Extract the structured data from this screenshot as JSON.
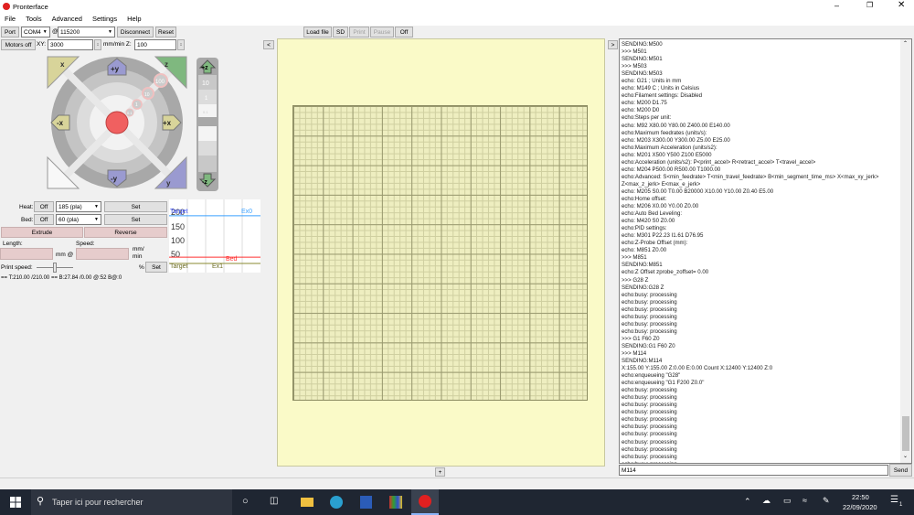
{
  "window": {
    "title": "Pronterface",
    "controls": [
      "minimize",
      "maximize",
      "close"
    ]
  },
  "menu": [
    "File",
    "Tools",
    "Advanced",
    "Settings",
    "Help"
  ],
  "toolbar": {
    "port_label": "Port",
    "port_value": "COM4",
    "at": "@",
    "baud": "115200",
    "disconnect": "Disconnect",
    "reset": "Reset",
    "motors_off": "Motors off",
    "xy_label": "XY:",
    "xy_value": "3000",
    "mm_min_z": "mm/min Z:",
    "z_value": "100",
    "collapse_left": "<"
  },
  "jog": {
    "home_x": "x",
    "home_z": "z",
    "plus_y": "+y",
    "minus_y": "-y",
    "minus_x": "-x",
    "plus_x": "+x",
    "home_y": "y",
    "steps": [
      "100",
      "10",
      "1",
      "0.1"
    ],
    "plus_z": "+z",
    "minus_z": "-z",
    "z_steps": [
      "10",
      "1",
      "0.1"
    ]
  },
  "temps": {
    "heat_label": "Heat:",
    "bed_label": "Bed:",
    "off": "Off",
    "heat_value": "185 (pla)",
    "bed_value": "60 (pla)",
    "set": "Set",
    "extrude": "Extrude",
    "reverse": "Reverse",
    "length_label": "Length:",
    "speed_label": "Speed:",
    "mm_at": "mm @",
    "mm_min": "mm/\nmin",
    "print_speed_label": "Print speed:",
    "percent": "%",
    "print_speed_fraction": 0.5,
    "status": "== T:210.00 /210.00 == B:27.84 /0.00 @:52 B@:0"
  },
  "chart_data": {
    "type": "line",
    "title": "",
    "ylabel": "",
    "ylim": [
      0,
      250
    ],
    "yticks": [
      "200",
      "150",
      "100",
      "50"
    ],
    "series": [
      {
        "name": "Target",
        "label": "Target",
        "color": "#3aa0ff",
        "value": 210
      },
      {
        "name": "Ex0",
        "label": "Ex0",
        "color": "#3aa0ff",
        "value": 210
      },
      {
        "name": "Bed",
        "label": "Bed",
        "color": "#ff3030",
        "value": 27.84
      },
      {
        "name": "Target",
        "label": "Target",
        "color": "#8a8a30",
        "value": 0
      },
      {
        "name": "Ex1",
        "label": "Ex1",
        "color": "#8a8a30",
        "value": 0
      }
    ]
  },
  "file_toolbar": {
    "load": "Load file",
    "sd": "SD",
    "print": "Print",
    "pause": "Pause",
    "off": "Off"
  },
  "plater": {
    "add": "+",
    "toggle_right": ">"
  },
  "console": {
    "lines": [
      "SENDING:M500",
      ">>> M501",
      "SENDING:M501",
      ">>> M503",
      "SENDING:M503",
      "echo:  G21    ; Units in mm",
      "echo:  M149 C ; Units in Celsius",
      "echo:Filament settings: Disabled",
      "echo:  M200 D1.75",
      "echo:  M200 D0",
      "echo:Steps per unit:",
      "echo:  M92 X80.00 Y80.00 Z400.00 E140.00",
      "echo:Maximum feedrates (units/s):",
      "echo:  M203 X300.00 Y300.00 Z5.00 E25.00",
      "echo:Maximum Acceleration (units/s2):",
      "echo:  M201 X500 Y500 Z100 E5000",
      "echo:Acceleration (units/s2): P<print_accel> R<retract_accel> T<travel_accel>",
      "echo:  M204 P500.00 R500.00 T1000.00",
      "echo:Advanced: S<min_feedrate> T<min_travel_feedrate> B<min_segment_time_ms> X<max_xy_jerk>",
      "Z<max_z_jerk> E<max_e_jerk>",
      "echo:  M205 S0.00 T0.00 B20000 X10.00 Y10.00 Z0.40 E5.00",
      "echo:Home offset:",
      "echo:  M206 X0.00 Y0.00 Z0.00",
      "echo:Auto Bed Leveling:",
      "echo:  M420 S0 Z0.00",
      "echo:PID settings:",
      "echo:  M301 P22.23 I1.61 D76.95",
      "echo:Z-Probe Offset (mm):",
      "echo:  M851 Z0.00",
      ">>> M851",
      "SENDING:M851",
      "echo:Z Offset  zprobe_zoffset= 0.00",
      ">>> G28 Z",
      "SENDING:G28 Z",
      "echo:busy: processing",
      "echo:busy: processing",
      "echo:busy: processing",
      "echo:busy: processing",
      "echo:busy: processing",
      "echo:busy: processing",
      ">>> G1 F60 Z0",
      "SENDING:G1 F60 Z0",
      ">>> M114",
      "SENDING:M114",
      "X:155.00 Y:155.00 Z:0.00 E:0.00 Count X:12400 Y:12400 Z:0",
      "echo:enqueueing \"G28\"",
      "echo:enqueueing \"G1 F200 Z0.0\"",
      "echo:busy: processing",
      "echo:busy: processing",
      "echo:busy: processing",
      "echo:busy: processing",
      "echo:busy: processing",
      "echo:busy: processing",
      "echo:busy: processing",
      "echo:busy: processing",
      "echo:busy: processing",
      "echo:busy: processing",
      "echo:busy: processing"
    ],
    "input_value": "M114",
    "send": "Send"
  },
  "taskbar": {
    "search_placeholder": "Taper ici pour rechercher",
    "time": "22:50",
    "date": "22/09/2020",
    "notifications": "1"
  }
}
